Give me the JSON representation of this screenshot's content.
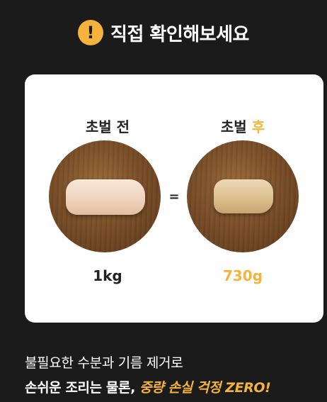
{
  "header": {
    "icon_name": "exclamation-icon",
    "icon_glyph": "!",
    "title": "직접 확인해보세요"
  },
  "comparison": {
    "before": {
      "label": "초벌 전",
      "weight": "1kg"
    },
    "after": {
      "label_prefix": "초벌",
      "label_highlight": "후",
      "weight": "730g"
    },
    "equals_sign": "="
  },
  "bottom": {
    "line1": "불필요한 수분과 기름 제거로",
    "line2_white": "손쉬운 조리는 물론,",
    "line2_yellow": "중량 손실 걱정 ZERO!"
  },
  "colors": {
    "background": "#1b1b1b",
    "accent": "#f6b33c",
    "card": "#ffffff"
  }
}
